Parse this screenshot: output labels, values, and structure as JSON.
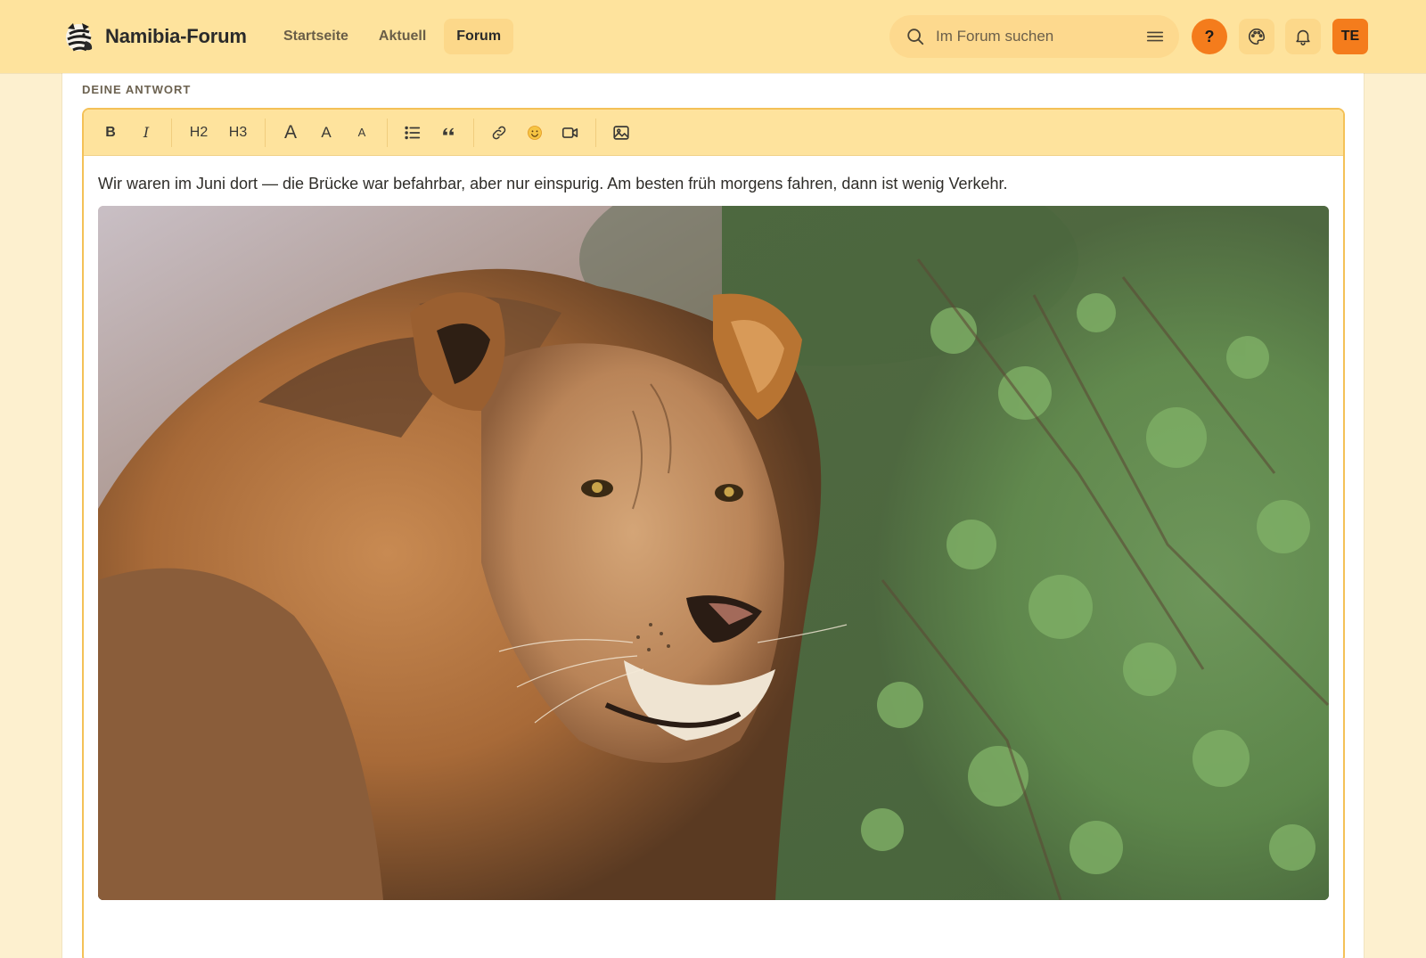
{
  "header": {
    "site_name": "Namibia-Forum",
    "nav": [
      {
        "label": "Startseite",
        "active": false
      },
      {
        "label": "Aktuell",
        "active": false
      },
      {
        "label": "Forum",
        "active": true
      }
    ],
    "search": {
      "placeholder": "Im Forum suchen",
      "value": ""
    },
    "help_label": "?",
    "avatar_initials": "TE",
    "icons": [
      "zebra-logo",
      "search-icon",
      "filter-icon",
      "palette-icon",
      "bell-icon"
    ]
  },
  "reply": {
    "section_label": "DEINE ANTWORT",
    "toolbar": {
      "bold": "B",
      "italic": "I",
      "h2": "H2",
      "h3": "H3",
      "font_large": "A",
      "font_medium": "A",
      "font_small": "A",
      "icons": [
        "bullet-list-icon",
        "quote-icon",
        "link-icon",
        "emoji-icon",
        "video-icon",
        "image-icon"
      ]
    },
    "body_text": "Wir waren im Juni dort — die Brücke war befahrbar, aber nur einspurig. Am besten früh morgens fahren, dann ist wenig Verkehr.",
    "embedded_image": "lion-photo"
  },
  "colors": {
    "header_bg": "#fee39d",
    "page_bg": "#fdf0cf",
    "accent_orange": "#f47c1c",
    "active_nav_bg": "#fcd88a",
    "editor_border": "#f4c157"
  }
}
